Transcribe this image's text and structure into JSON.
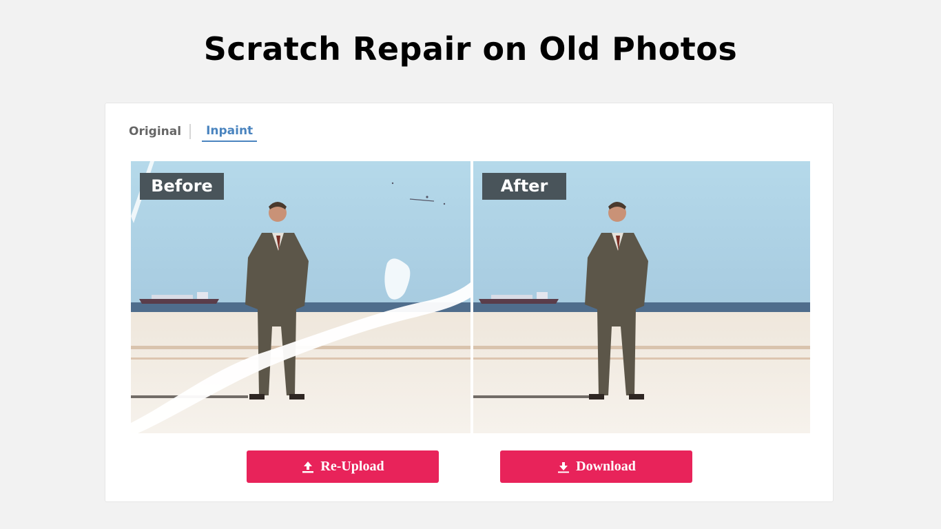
{
  "header": {
    "title": "Scratch Repair on Old Photos"
  },
  "tabs": [
    {
      "label": "Original",
      "active": false
    },
    {
      "label": "Inpaint",
      "active": true
    }
  ],
  "comparison": {
    "before_label": "Before",
    "after_label": "After"
  },
  "actions": {
    "reupload_label": "Re-Upload",
    "reupload_icon": "upload-icon",
    "download_label": "Download",
    "download_icon": "download-icon"
  },
  "colors": {
    "accent": "#e8235a",
    "tab_active": "#4a84bf",
    "label_bg": "#49545a"
  }
}
